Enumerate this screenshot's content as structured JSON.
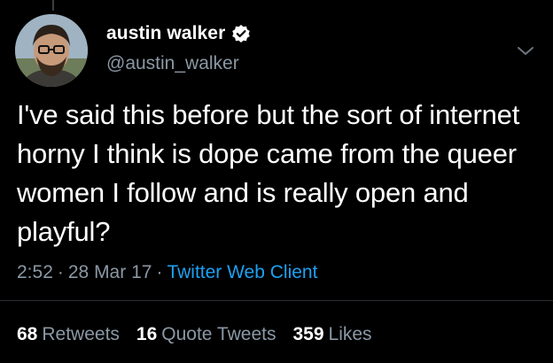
{
  "tweet": {
    "author": {
      "display_name": "austin walker",
      "handle": "@austin_walker",
      "verified": true,
      "avatar_icon": "profile-photo"
    },
    "text": "I've said this before but the sort of internet horny I think is dope came from the queer women I follow and is really open and playful?",
    "time": "2:52",
    "date": "28 Mar 17",
    "separator": "·",
    "client": "Twitter Web Client",
    "stats": {
      "retweets_count": "68",
      "retweets_label": "Retweets",
      "quote_count": "16",
      "quote_label": "Quote Tweets",
      "likes_count": "359",
      "likes_label": "Likes"
    }
  },
  "colors": {
    "background": "#000000",
    "text": "#ffffff",
    "secondary": "#8b98a5",
    "accent": "#1da1f2"
  },
  "icons": {
    "verified": "verified-badge-icon",
    "menu": "chevron-down-icon"
  }
}
